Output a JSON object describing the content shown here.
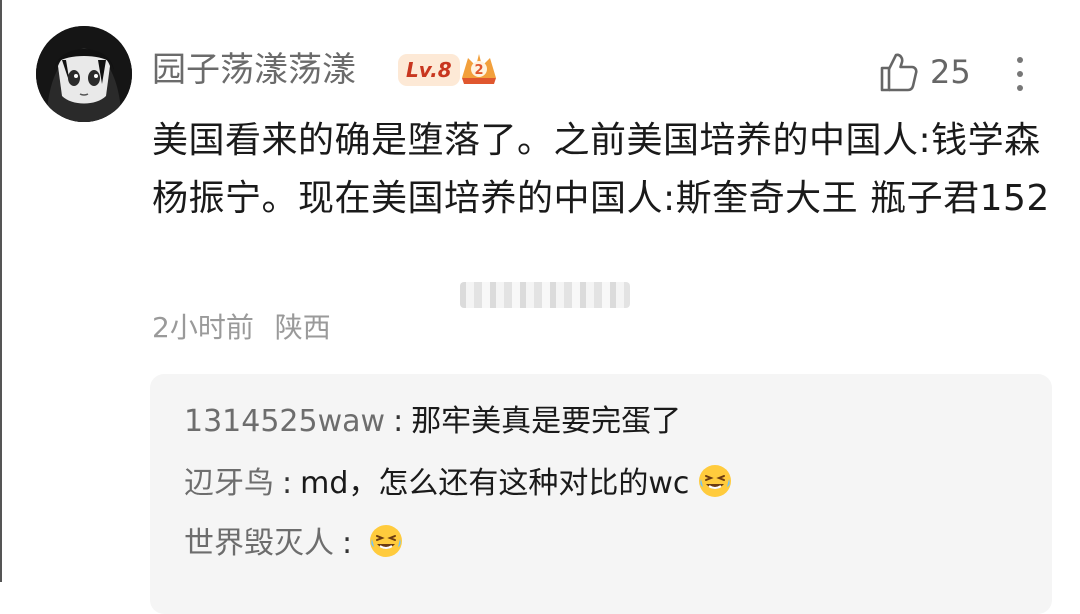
{
  "comment": {
    "username": "园子荡漾荡漾",
    "level_badge": "Lv.8",
    "fan_badge_number": "2",
    "like_count": "25",
    "text": "美国看来的确是堕落了。之前美国培养的中国人:钱学森 杨振宁。现在美国培养的中国人:斯奎奇大王 瓶子君152",
    "time": "2小时前",
    "location": "陕西"
  },
  "replies": [
    {
      "name": "1314525waw",
      "separator": ":",
      "text": "那牢美真是要完蛋了",
      "emoji": ""
    },
    {
      "name": "辺牙鸟",
      "separator": ":",
      "text": "md，怎么还有这种对比的wc",
      "emoji": "laughing-tears-emoji"
    },
    {
      "name": "世界毁灭人",
      "separator": ":",
      "text": "",
      "emoji": "laughing-tears-emoji"
    }
  ],
  "colors": {
    "badge_bg": "#fde9d6",
    "badge_text": "#c8361f",
    "reply_bg": "#f5f5f5",
    "meta_text": "#9a9a9a"
  }
}
